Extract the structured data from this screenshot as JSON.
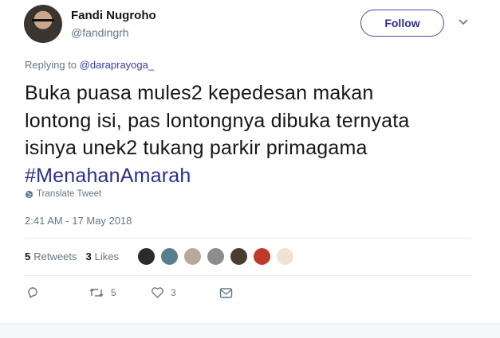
{
  "author": {
    "name": "Fandi Nugroho",
    "handle": "@fandingrh"
  },
  "follow_label": "Follow",
  "replying": {
    "prefix": "Replying to",
    "target": "@daraprayoga_"
  },
  "tweet": {
    "lines": [
      "Buka puasa mules2 kepedesan makan",
      "lontong isi, pas lontongnya dibuka ternyata",
      "isinya unek2 tukang parkir primagama"
    ],
    "hashtag": "#MenahanAmarah"
  },
  "translate_label": "Translate Tweet",
  "timestamp": "2:41 AM - 17 May 2018",
  "stats": {
    "retweets_count": "5",
    "retweets_label": "Retweets",
    "likes_count": "3",
    "likes_label": "Likes"
  },
  "likers": [
    {
      "icon": "liker-avatar",
      "color": "#2b2b2b"
    },
    {
      "icon": "liker-avatar",
      "color": "#5a7f8c"
    },
    {
      "icon": "liker-avatar",
      "color": "#b8a89a"
    },
    {
      "icon": "liker-avatar",
      "color": "#8d8d8d"
    },
    {
      "icon": "liker-avatar",
      "color": "#4a3b33"
    },
    {
      "icon": "liker-avatar",
      "color": "#c0392b"
    },
    {
      "icon": "liker-avatar",
      "color": "#f1e3d3"
    }
  ],
  "actions": {
    "reply_count": "",
    "retweet_count": "5",
    "like_count": "3"
  },
  "colors": {
    "accent": "#2b2d8f",
    "muted": "#657786",
    "text": "#14171a"
  }
}
